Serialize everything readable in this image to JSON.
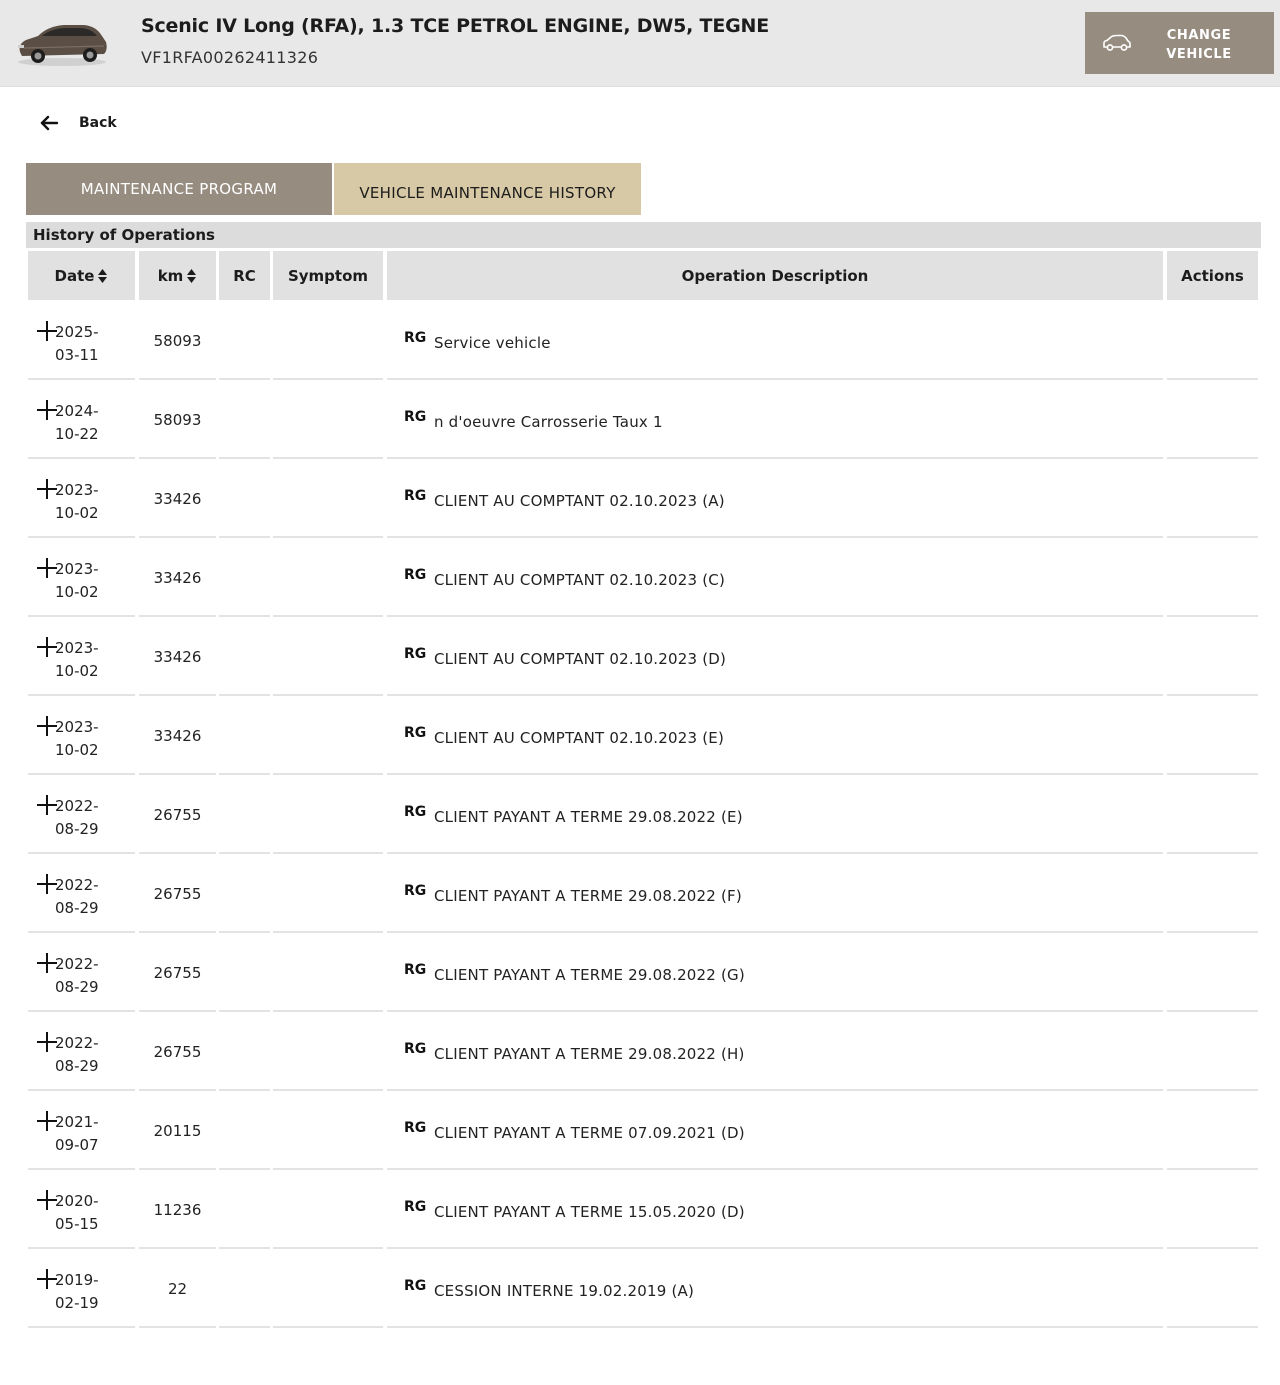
{
  "header": {
    "vehicle_title": "Scenic IV Long (RFA), 1.3 TCE PETROL ENGINE, DW5, TEGNE",
    "vin": "VF1RFA00262411326",
    "change_vehicle_label": "CHANGE VEHICLE"
  },
  "nav": {
    "back_label": "Back"
  },
  "tabs": [
    {
      "label": "MAINTENANCE PROGRAM",
      "active": false
    },
    {
      "label": "VEHICLE MAINTENANCE HISTORY",
      "active": true
    }
  ],
  "history": {
    "section_title": "History of Operations",
    "columns": {
      "date": "Date",
      "km": "km",
      "rc": "RC",
      "symptom": "Symptom",
      "description": "Operation Description",
      "actions": "Actions"
    },
    "rows": [
      {
        "date": "2025-03-11",
        "km": "58093",
        "rc": "",
        "symptom": "",
        "type": "RG",
        "description": "Service vehicle"
      },
      {
        "date": "2024-10-22",
        "km": "58093",
        "rc": "",
        "symptom": "",
        "type": "RG",
        "description": "n d'oeuvre Carrosserie Taux 1"
      },
      {
        "date": "2023-10-02",
        "km": "33426",
        "rc": "",
        "symptom": "",
        "type": "RG",
        "description": "CLIENT AU COMPTANT 02.10.2023 (A)"
      },
      {
        "date": "2023-10-02",
        "km": "33426",
        "rc": "",
        "symptom": "",
        "type": "RG",
        "description": "CLIENT AU COMPTANT 02.10.2023 (C)"
      },
      {
        "date": "2023-10-02",
        "km": "33426",
        "rc": "",
        "symptom": "",
        "type": "RG",
        "description": "CLIENT AU COMPTANT 02.10.2023 (D)"
      },
      {
        "date": "2023-10-02",
        "km": "33426",
        "rc": "",
        "symptom": "",
        "type": "RG",
        "description": "CLIENT AU COMPTANT 02.10.2023 (E)"
      },
      {
        "date": "2022-08-29",
        "km": "26755",
        "rc": "",
        "symptom": "",
        "type": "RG",
        "description": "CLIENT PAYANT A TERME 29.08.2022 (E)"
      },
      {
        "date": "2022-08-29",
        "km": "26755",
        "rc": "",
        "symptom": "",
        "type": "RG",
        "description": "CLIENT PAYANT A TERME 29.08.2022 (F)"
      },
      {
        "date": "2022-08-29",
        "km": "26755",
        "rc": "",
        "symptom": "",
        "type": "RG",
        "description": "CLIENT PAYANT A TERME 29.08.2022 (G)"
      },
      {
        "date": "2022-08-29",
        "km": "26755",
        "rc": "",
        "symptom": "",
        "type": "RG",
        "description": "CLIENT PAYANT A TERME 29.08.2022 (H)"
      },
      {
        "date": "2021-09-07",
        "km": "20115",
        "rc": "",
        "symptom": "",
        "type": "RG",
        "description": "CLIENT PAYANT A TERME 07.09.2021 (D)"
      },
      {
        "date": "2020-05-15",
        "km": "11236",
        "rc": "",
        "symptom": "",
        "type": "RG",
        "description": "CLIENT PAYANT A TERME 15.05.2020 (D)"
      },
      {
        "date": "2019-02-19",
        "km": "22",
        "rc": "",
        "symptom": "",
        "type": "RG",
        "description": "CESSION INTERNE 19.02.2019 (A)"
      }
    ]
  },
  "colors": {
    "topbar_bg": "#e8e8e8",
    "button_taupe": "#968c80",
    "tab_active_bg": "#d7c9a5",
    "header_cell_bg": "#e1e1e1",
    "row_separator": "#e3e3e3"
  },
  "icons": {
    "vehicle_thumbnail": "car-image",
    "change_vehicle": "car-outline-icon",
    "back": "arrow-left-icon",
    "sort": "sort-updown-icon",
    "expand": "plus-icon"
  }
}
